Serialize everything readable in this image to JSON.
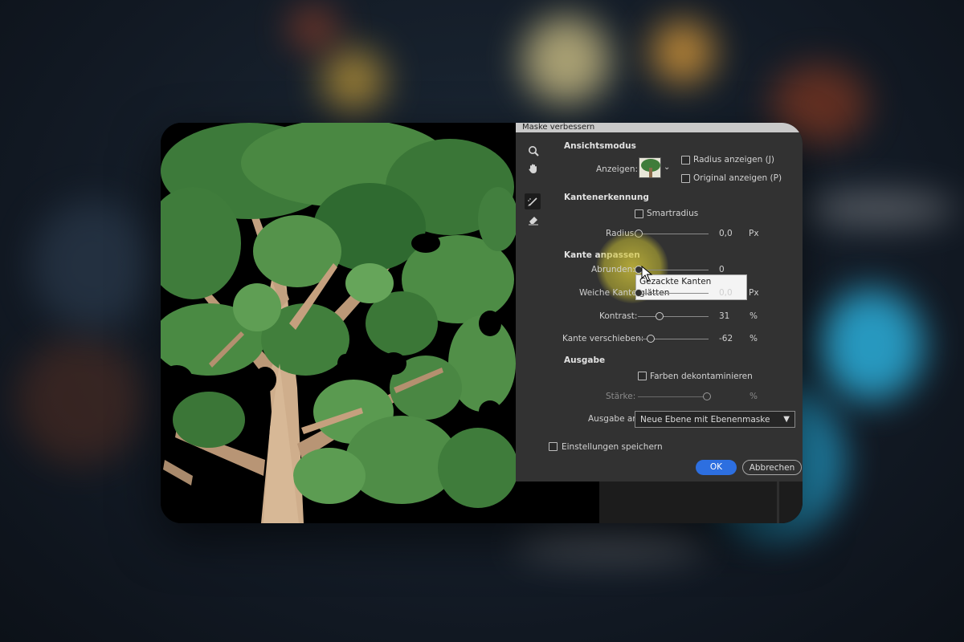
{
  "dialog": {
    "title": "Maske verbessern",
    "view_mode": {
      "heading": "Ansichtsmodus",
      "show_label": "Anzeigen:",
      "show_radius_label": "Radius anzeigen (J)",
      "show_original_label": "Original anzeigen (P)"
    },
    "edge_detection": {
      "heading": "Kantenerkennung",
      "smart_radius_label": "Smartradius",
      "radius_label": "Radius:",
      "radius_value": "0,0",
      "radius_unit": "Px"
    },
    "adjust_edge": {
      "heading": "Kante anpassen",
      "smooth_label": "Abrunden:",
      "smooth_value": "0",
      "feather_label": "Weiche Kante:",
      "feather_value": "0,0",
      "feather_unit": "Px",
      "contrast_label": "Kontrast:",
      "contrast_value": "31",
      "contrast_unit": "%",
      "shift_label": "Kante verschieben:",
      "shift_value": "-62",
      "shift_unit": "%"
    },
    "output": {
      "heading": "Ausgabe",
      "decontaminate_label": "Farben dekontaminieren",
      "amount_label": "Stärke:",
      "amount_unit": "%",
      "output_to_label": "Ausgabe an:",
      "output_to_value": "Neue Ebene mit Ebenenmaske"
    },
    "remember_label": "Einstellungen speichern",
    "ok_label": "OK",
    "cancel_label": "Abbrechen",
    "tooltip": "Gezackte Kanten glätten"
  },
  "tools": [
    "zoom-icon",
    "hand-icon",
    "refine-radius-brush-icon",
    "erase-refinements-icon"
  ],
  "colors": {
    "dialog_bg": "#323232",
    "accent": "#2d6fe0",
    "highlight": "#d8cc3c"
  }
}
